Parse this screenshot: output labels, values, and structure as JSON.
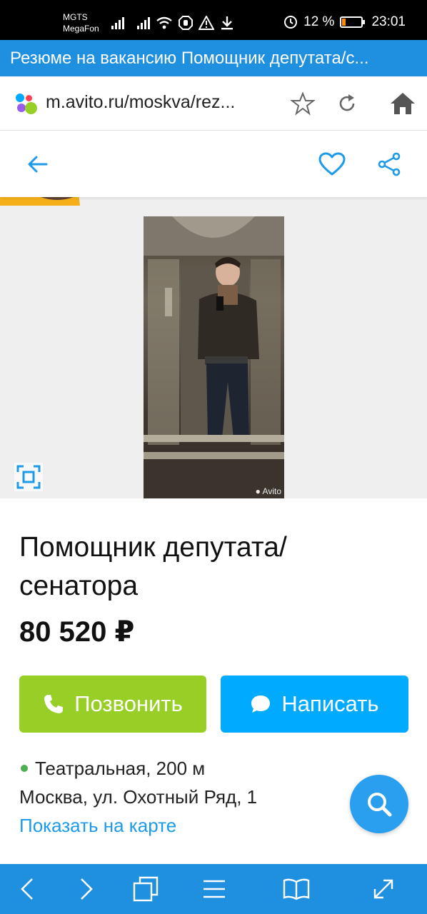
{
  "status_bar": {
    "carrier1": "MGTS",
    "carrier2": "MegaFon",
    "battery": "12 %",
    "time": "23:01",
    "battery_color": "#ff8a00"
  },
  "browser": {
    "page_title": "Резюме на вакансию Помощник депутата/с...",
    "url": "m.avito.ru/moskva/rez...",
    "accent": "#1f8fe0",
    "icons": [
      "star-icon",
      "reload-icon",
      "home-icon"
    ]
  },
  "app_header": {
    "icons": [
      "back-arrow-icon",
      "heart-icon",
      "share-icon"
    ],
    "icon_color": "#1e9be8"
  },
  "gallery": {
    "watermark": "Avito",
    "background": "#efefef"
  },
  "ad": {
    "title_line1": "Помощник депутата/",
    "title_line2": "сенатора",
    "price": "80 520 ₽"
  },
  "actions": {
    "call_label": "Позвонить",
    "message_label": "Написать",
    "call_color": "#97cf26",
    "message_color": "#00aaff"
  },
  "location": {
    "metro": "Театральная, 200 м",
    "metro_dot_color": "#4caf50",
    "address": "Москва, ул. Охотный Ряд, 1",
    "map_link": "Показать на карте"
  },
  "bottom_bar": {
    "icons": [
      "back-icon",
      "forward-icon",
      "tabs-icon",
      "menu-icon",
      "book-icon",
      "fullscreen-icon"
    ]
  }
}
